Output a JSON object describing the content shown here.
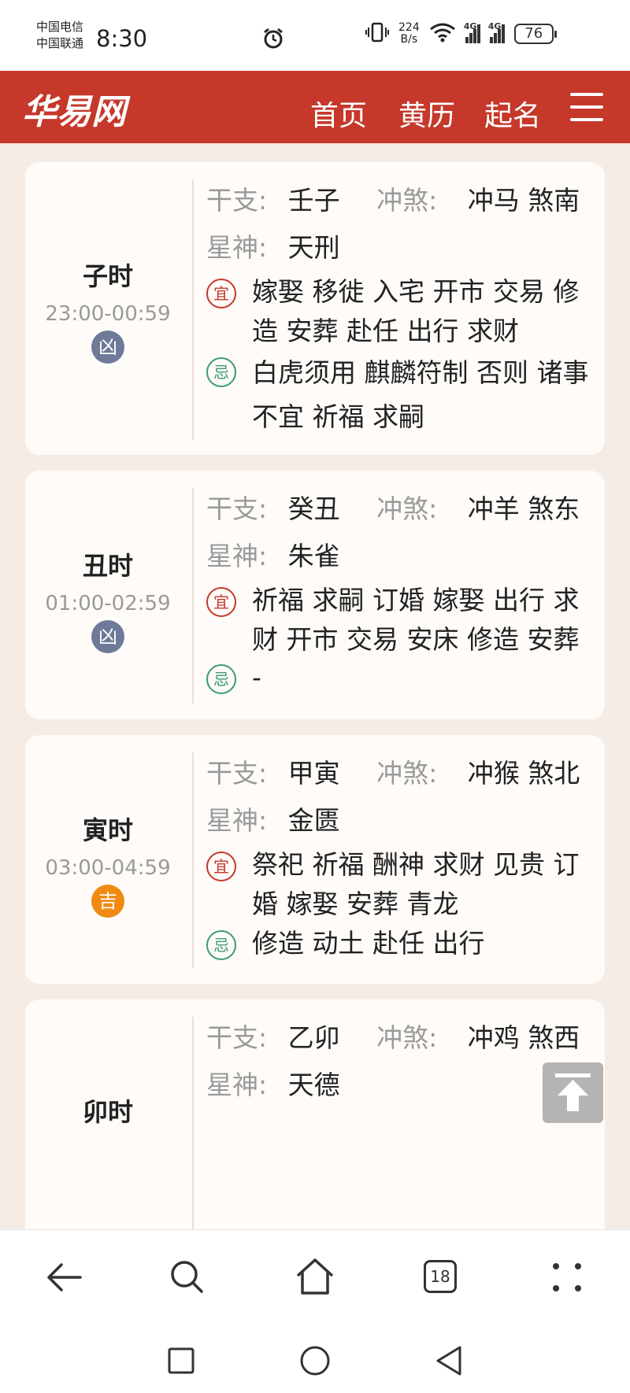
{
  "status_bar": {
    "carrier_1": "中国电信",
    "carrier_2": "中国联通",
    "time": "8:30",
    "net_speed_value": "224",
    "net_speed_unit": "B/s",
    "signal_1": "4G",
    "signal_2": "4G",
    "battery": "76"
  },
  "header": {
    "logo": "华易网",
    "nav": [
      "首页",
      "黄历",
      "起名"
    ]
  },
  "labels": {
    "ganzhi": "干支:",
    "chongsha": "冲煞:",
    "xingshen": "星神:",
    "yi": "宜",
    "ji": "忌"
  },
  "hours": [
    {
      "name": "子时",
      "range": "23:00-00:59",
      "luck": "凶",
      "ganzhi": "壬子",
      "chongsha": "冲马 煞南",
      "xingshen": "天刑",
      "yi": "嫁娶 移徙 入宅 开市 交易 修造 安葬 赴任 出行 求财",
      "ji": "白虎须用 麒麟符制 否则 诸事不宜 祈福 求嗣"
    },
    {
      "name": "丑时",
      "range": "01:00-02:59",
      "luck": "凶",
      "ganzhi": "癸丑",
      "chongsha": "冲羊 煞东",
      "xingshen": "朱雀",
      "yi": "祈福 求嗣 订婚 嫁娶 出行 求财 开市 交易 安床 修造 安葬",
      "ji": "-"
    },
    {
      "name": "寅时",
      "range": "03:00-04:59",
      "luck": "吉",
      "ganzhi": "甲寅",
      "chongsha": "冲猴 煞北",
      "xingshen": "金匮",
      "yi": "祭祀 祈福 酬神 求财 见贵 订婚 嫁娶 安葬 青龙",
      "ji": "修造 动土 赴任 出行"
    },
    {
      "name": "卯时",
      "ganzhi": "乙卯",
      "chongsha": "冲鸡 煞西",
      "xingshen": "天德"
    }
  ],
  "browser": {
    "tab_count": "18"
  },
  "colors": {
    "header_bg": "#c5382a",
    "page_bg": "#f6ece6",
    "bad_luck": "#6e7a98",
    "good_luck": "#f08a13",
    "yi_tag": "#c5382a",
    "ji_tag": "#3d9b6f"
  },
  "icons": {
    "alarm": "alarm-clock-icon",
    "vibrate": "vibrate-icon",
    "wifi": "wifi-icon",
    "back_to_top": "arrow-up-icon",
    "back": "back-arrow-icon",
    "search": "search-icon",
    "home": "home-icon",
    "more": "more-dots-icon"
  }
}
